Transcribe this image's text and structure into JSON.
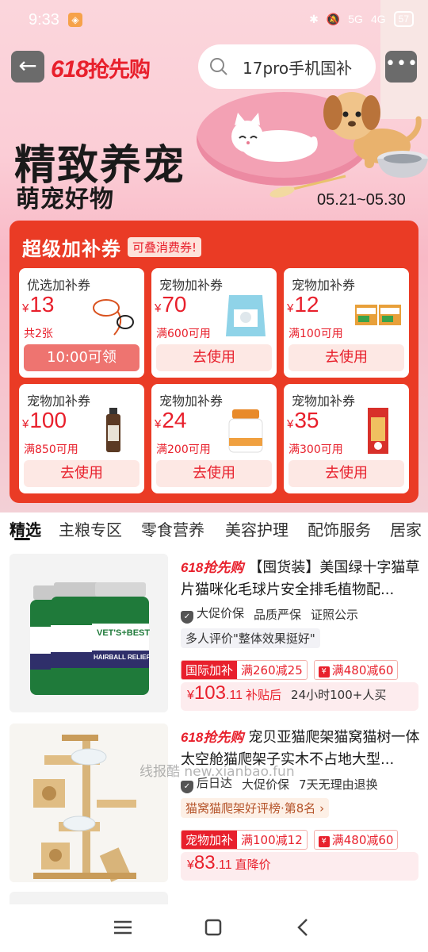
{
  "status_bar": {
    "time": "9:33",
    "app_badge": "◈",
    "signal_5g": "5G",
    "signal_4g": "4G",
    "battery": "57"
  },
  "nav": {
    "brand_num": "618",
    "brand_text": "抢先购",
    "search_placeholder": "17pro手机国补",
    "more_label": "•••"
  },
  "hero": {
    "title": "精致养宠",
    "subtitle": "萌宠好物",
    "date_range": "05.21~05.30"
  },
  "coupons": {
    "title": "超级加补券",
    "tag": "可叠消费券!",
    "currency": "¥",
    "items": [
      {
        "name": "优选加补券",
        "amount": "13",
        "condition": "共2张",
        "button": "10:00可领",
        "image": "leash-icon"
      },
      {
        "name": "宠物加补券",
        "amount": "70",
        "condition": "满600可用",
        "button": "去使用",
        "image": "cat-food-bag-icon"
      },
      {
        "name": "宠物加补券",
        "amount": "12",
        "condition": "满100可用",
        "button": "去使用",
        "image": "treat-box-icon"
      },
      {
        "name": "宠物加补券",
        "amount": "100",
        "condition": "满850可用",
        "button": "去使用",
        "image": "shampoo-bottle-icon"
      },
      {
        "name": "宠物加补券",
        "amount": "24",
        "condition": "满200可用",
        "button": "去使用",
        "image": "supplement-jar-icon"
      },
      {
        "name": "宠物加补券",
        "amount": "35",
        "condition": "满300可用",
        "button": "去使用",
        "image": "snack-bag-icon"
      }
    ]
  },
  "tabs": [
    "精选",
    "主粮专区",
    "零食营养",
    "美容护理",
    "配饰服务",
    "居家"
  ],
  "products": [
    {
      "brand_tag": "618抢先购",
      "title": "【囤货装】美国绿十字猫草片猫咪化毛球片安全排毛植物配...",
      "tags": [
        "大促价保",
        "品质严保",
        "证照公示"
      ],
      "badge": "多人评价\"整体效果挺好\"",
      "promo1_label": "国际加补",
      "promo1_value": "满260减25",
      "promo2_value": "满480减60",
      "price_int": "103",
      "price_dec": ".11",
      "price_label": "补贴后",
      "price_extra": "24小时100+人买",
      "image_label": "VET'S+BEST",
      "image_sub": "HAIRBALL RELIEF"
    },
    {
      "brand_tag": "618抢先购",
      "title": "宠贝亚猫爬架猫窝猫树一体太空舱猫爬架子实木不占地大型...",
      "tags": [
        "后日达",
        "大促价保",
        "7天无理由退换"
      ],
      "badge": "猫窝猫爬架好评榜·第8名 ›",
      "promo1_label": "宠物加补",
      "promo1_value": "满100减12",
      "promo2_value": "满480减60",
      "price_int": "83",
      "price_dec": ".11",
      "price_label": "直降价",
      "price_extra": "",
      "image_label": "cat-tree",
      "image_sub": ""
    }
  ],
  "currency": "¥",
  "watermark": "线报酷 new.xianbao.fun",
  "colors": {
    "brand_red": "#e8202c",
    "panel_red": "#ea3b25",
    "hero_pink": "#fbd6dc"
  }
}
